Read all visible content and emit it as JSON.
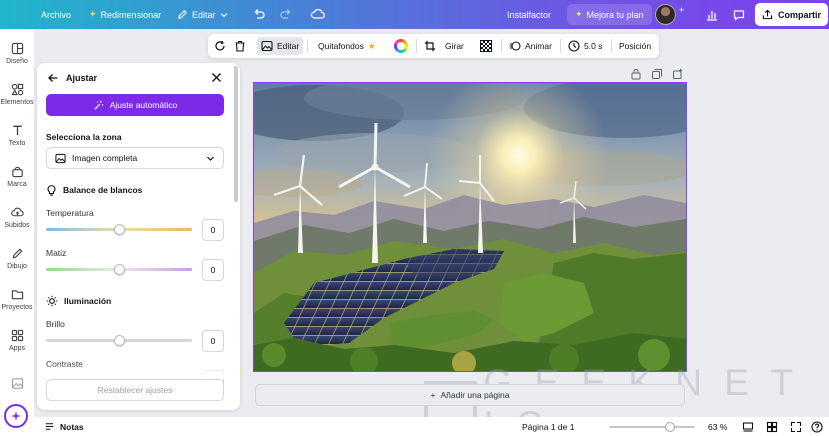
{
  "topbar": {
    "file": "Archivo",
    "resize": "Redimensionar",
    "edit": "Editar",
    "install": "Instalfactor",
    "upgrade": "Mejora tu plan",
    "share": "Compartir"
  },
  "rail": [
    {
      "label": "Diseño",
      "icon": "layout-icon"
    },
    {
      "label": "Elementos",
      "icon": "shapes-icon"
    },
    {
      "label": "Texto",
      "icon": "text-icon"
    },
    {
      "label": "Marca",
      "icon": "brand-icon"
    },
    {
      "label": "Subidos",
      "icon": "cloud-upload-icon"
    },
    {
      "label": "Dibujo",
      "icon": "pen-icon"
    },
    {
      "label": "Proyectos",
      "icon": "folder-icon"
    },
    {
      "label": "Apps",
      "icon": "apps-icon"
    }
  ],
  "panel": {
    "title": "Ajustar",
    "auto_button": "Ajuste automático",
    "zone_label": "Selecciona la zona",
    "zone_value": "Imagen completa",
    "white_balance": "Balance de blancos",
    "lighting": "Iluminación",
    "sliders": [
      {
        "label": "Temperatura",
        "value": "0",
        "position": 0.5
      },
      {
        "label": "Matiz",
        "value": "0",
        "position": 0.5
      },
      {
        "label": "Brillo",
        "value": "0",
        "position": 0.5
      },
      {
        "label": "Contraste",
        "value": "",
        "position": 0.5
      }
    ],
    "reset": "Restablecer ajustes"
  },
  "context_toolbar": {
    "edit": "Editar",
    "bg_remover": "Quitafondos",
    "flip": "Girar",
    "animate": "Animar",
    "duration": "5.0 s",
    "position": "Posición"
  },
  "canvas": {
    "add_page": "Añadir una página"
  },
  "watermark": "G E E K N E T I C",
  "status": {
    "notes": "Notas",
    "page": "Página 1 de 1",
    "zoom": "63 %",
    "zoom_level": 0.63
  },
  "colors": {
    "accent": "#7d2ae8",
    "selection": "#8b3dff"
  }
}
